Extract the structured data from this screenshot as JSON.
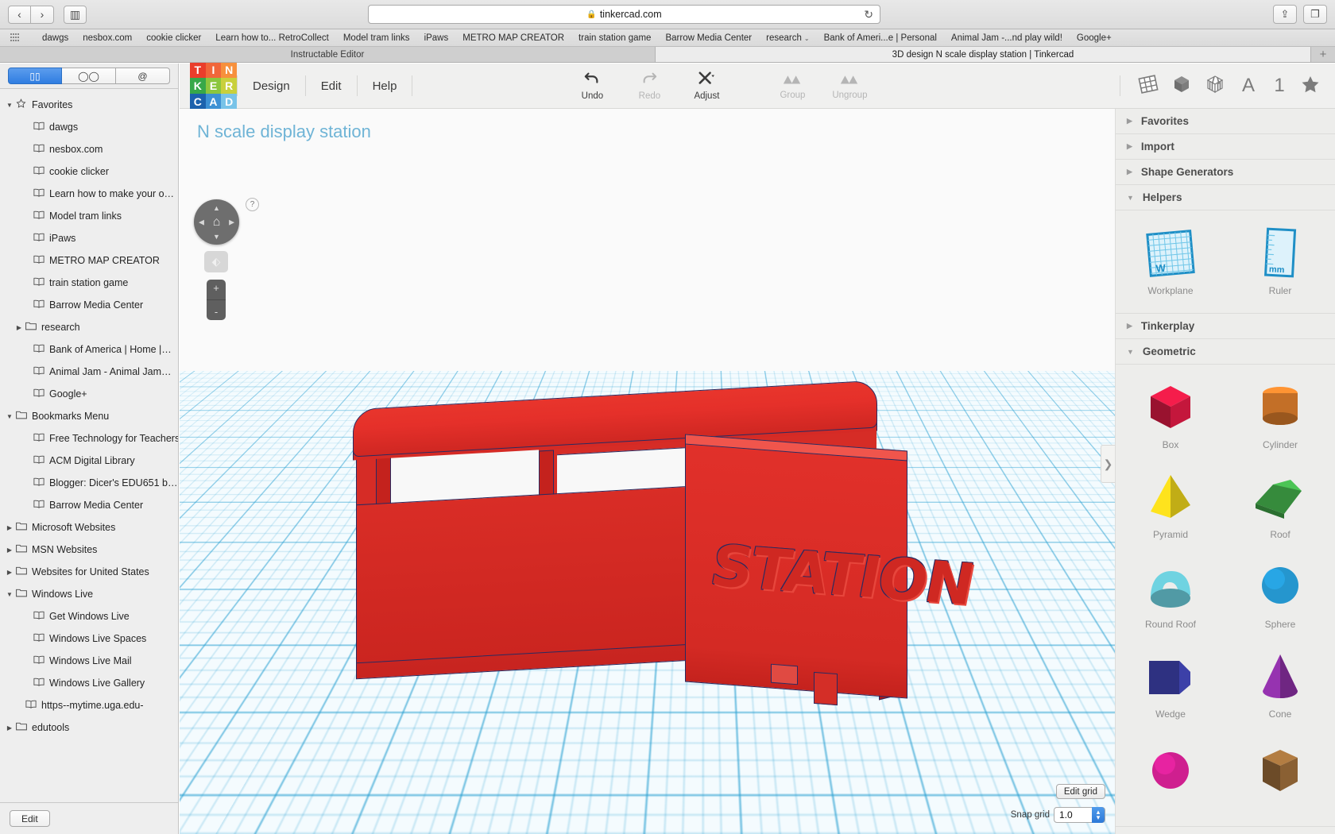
{
  "browser": {
    "back_label": "‹",
    "forward_label": "›",
    "sidebar_toggle_label": "▥",
    "url": "tinkercad.com",
    "lock_icon": "lock-icon",
    "reload_icon": "reload-icon",
    "share_label": "⇪",
    "tabs_overview_label": "❐",
    "bookmarks_bar": [
      {
        "label": "dawgs"
      },
      {
        "label": "nesbox.com"
      },
      {
        "label": "cookie clicker"
      },
      {
        "label": "Learn how to... RetroCollect"
      },
      {
        "label": "Model tram links"
      },
      {
        "label": "iPaws"
      },
      {
        "label": "METRO MAP CREATOR"
      },
      {
        "label": "train station game"
      },
      {
        "label": "Barrow Media Center"
      },
      {
        "label": "research",
        "caret": "⌄"
      },
      {
        "label": "Bank of Ameri...e | Personal"
      },
      {
        "label": "Animal Jam -...nd play wild!"
      },
      {
        "label": "Google+"
      }
    ],
    "tabs": [
      {
        "title": "Instructable Editor",
        "active": false
      },
      {
        "title": "3D design N scale display station | Tinkercad",
        "active": true
      }
    ],
    "new_tab_label": "+"
  },
  "sidebar": {
    "tabs": [
      {
        "icon": "bookmarks-icon",
        "glyph": "▯▯",
        "active": true
      },
      {
        "icon": "reading-list-icon",
        "glyph": "◯◯",
        "active": false
      },
      {
        "icon": "shared-links-icon",
        "glyph": "@",
        "active": false
      }
    ],
    "items": [
      {
        "label": "Favorites",
        "type": "folder",
        "tri": "▼",
        "icon": "star-icon",
        "glyph": "☆",
        "level": 0
      },
      {
        "label": "dawgs",
        "type": "bookmark",
        "icon": "book-icon",
        "glyph": "▥",
        "level": 1
      },
      {
        "label": "nesbox.com",
        "type": "bookmark",
        "icon": "book-icon",
        "glyph": "▥",
        "level": 1
      },
      {
        "label": "cookie clicker",
        "type": "bookmark",
        "icon": "book-icon",
        "glyph": "▥",
        "level": 1
      },
      {
        "label": "Learn how to make your o…",
        "type": "bookmark",
        "icon": "book-icon",
        "glyph": "▥",
        "level": 1
      },
      {
        "label": "Model tram links",
        "type": "bookmark",
        "icon": "book-icon",
        "glyph": "▥",
        "level": 1
      },
      {
        "label": "iPaws",
        "type": "bookmark",
        "icon": "book-icon",
        "glyph": "▥",
        "level": 1
      },
      {
        "label": "METRO MAP CREATOR",
        "type": "bookmark",
        "icon": "book-icon",
        "glyph": "▥",
        "level": 1
      },
      {
        "label": "train station game",
        "type": "bookmark",
        "icon": "book-icon",
        "glyph": "▥",
        "level": 1
      },
      {
        "label": "Barrow Media Center",
        "type": "bookmark",
        "icon": "book-icon",
        "glyph": "▥",
        "level": 1
      },
      {
        "label": "research",
        "type": "folder",
        "tri": "▶",
        "icon": "folder-icon",
        "glyph": "▭",
        "level": 1,
        "indentFolder": true
      },
      {
        "label": "Bank of America | Home |…",
        "type": "bookmark",
        "icon": "book-icon",
        "glyph": "▥",
        "level": 1
      },
      {
        "label": "Animal Jam - Animal Jam…",
        "type": "bookmark",
        "icon": "book-icon",
        "glyph": "▥",
        "level": 1
      },
      {
        "label": "Google+",
        "type": "bookmark",
        "icon": "book-icon",
        "glyph": "▥",
        "level": 1
      },
      {
        "label": "Bookmarks Menu",
        "type": "folder",
        "tri": "▼",
        "icon": "folder-icon",
        "glyph": "▭",
        "level": 0
      },
      {
        "label": "Free Technology for Teachers",
        "type": "bookmark",
        "icon": "book-icon",
        "glyph": "▥",
        "level": 1
      },
      {
        "label": "ACM Digital Library",
        "type": "bookmark",
        "icon": "book-icon",
        "glyph": "▥",
        "level": 1
      },
      {
        "label": "Blogger: Dicer's EDU651 b…",
        "type": "bookmark",
        "icon": "book-icon",
        "glyph": "▥",
        "level": 1
      },
      {
        "label": "Barrow Media Center",
        "type": "bookmark",
        "icon": "book-icon",
        "glyph": "▥",
        "level": 1
      },
      {
        "label": "Microsoft Websites",
        "type": "folder",
        "tri": "▶",
        "icon": "folder-icon",
        "glyph": "▭",
        "level": 0
      },
      {
        "label": "MSN Websites",
        "type": "folder",
        "tri": "▶",
        "icon": "folder-icon",
        "glyph": "▭",
        "level": 0
      },
      {
        "label": "Websites for United States",
        "type": "folder",
        "tri": "▶",
        "icon": "folder-icon",
        "glyph": "▭",
        "level": 0
      },
      {
        "label": "Windows Live",
        "type": "folder",
        "tri": "▼",
        "icon": "folder-icon",
        "glyph": "▭",
        "level": 0
      },
      {
        "label": "Get Windows Live",
        "type": "bookmark",
        "icon": "book-icon",
        "glyph": "▥",
        "level": 1
      },
      {
        "label": "Windows Live Spaces",
        "type": "bookmark",
        "icon": "book-icon",
        "glyph": "▥",
        "level": 1
      },
      {
        "label": "Windows Live Mail",
        "type": "bookmark",
        "icon": "book-icon",
        "glyph": "▥",
        "level": 1
      },
      {
        "label": "Windows Live Gallery",
        "type": "bookmark",
        "icon": "book-icon",
        "glyph": "▥",
        "level": 1
      },
      {
        "label": "https--mytime.uga.edu-",
        "type": "bookmark",
        "icon": "book-icon",
        "glyph": "▥",
        "level": 0,
        "halfIndent": true
      },
      {
        "label": "edutools",
        "type": "folder",
        "tri": "▶",
        "icon": "folder-icon",
        "glyph": "▭",
        "level": 0
      }
    ],
    "edit_button": "Edit"
  },
  "tinkercad": {
    "logo_letters": [
      {
        "ch": "T",
        "color": "#ea3d2b"
      },
      {
        "ch": "I",
        "color": "#f1663a"
      },
      {
        "ch": "N",
        "color": "#f7903c"
      },
      {
        "ch": "K",
        "color": "#37a849"
      },
      {
        "ch": "E",
        "color": "#8cc63e"
      },
      {
        "ch": "R",
        "color": "#c9d03c"
      },
      {
        "ch": "C",
        "color": "#1c62ad"
      },
      {
        "ch": "A",
        "color": "#3d91d4"
      },
      {
        "ch": "D",
        "color": "#78c3e8"
      }
    ],
    "menus": [
      {
        "label": "Design"
      },
      {
        "label": "Edit"
      },
      {
        "label": "Help"
      }
    ],
    "tools": [
      {
        "label": "Undo",
        "icon": "undo-icon",
        "glyph": "↶",
        "disabled": false
      },
      {
        "label": "Redo",
        "icon": "redo-icon",
        "glyph": "↷",
        "disabled": true
      },
      {
        "label": "Adjust",
        "icon": "adjust-icon",
        "glyph": "✄",
        "disabled": false
      },
      {
        "label": "Group",
        "icon": "group-icon",
        "glyph": "▲▲",
        "disabled": true
      },
      {
        "label": "Ungroup",
        "icon": "ungroup-icon",
        "glyph": "▲▲",
        "disabled": true
      }
    ],
    "right_icons": [
      {
        "icon": "workplane-grid-icon",
        "glyph": "▦"
      },
      {
        "icon": "solid-box-icon",
        "glyph": "⬢"
      },
      {
        "icon": "striped-box-icon",
        "glyph": "⬡"
      },
      {
        "icon": "text-tool-icon",
        "glyph": "A"
      },
      {
        "icon": "number-tool-icon",
        "glyph": "1"
      },
      {
        "icon": "star-tool-icon",
        "glyph": "★"
      }
    ],
    "design_title": "N scale display station",
    "model_text": "STATION",
    "help_badge": "?",
    "nav": {
      "up": "▲",
      "down": "▼",
      "left": "◀",
      "right": "▶",
      "home_icon": "home-icon",
      "home": "⌂",
      "fit_icon": "fit-view-icon",
      "fit": "⬖",
      "zoom_in": "+",
      "zoom_out": "-"
    },
    "edit_grid_button": "Edit grid",
    "snap_grid_label": "Snap grid",
    "snap_grid_value": "1.0",
    "panel_handle": "❯",
    "panel": {
      "sections": [
        {
          "name": "Favorites",
          "tri": "▶",
          "expanded": false,
          "shapes": []
        },
        {
          "name": "Import",
          "tri": "▶",
          "expanded": false,
          "shapes": []
        },
        {
          "name": "Shape Generators",
          "tri": "▶",
          "expanded": false,
          "shapes": []
        },
        {
          "name": "Helpers",
          "tri": "▼",
          "expanded": true,
          "shapes": [
            {
              "label": "Workplane",
              "kind": "workplane",
              "color": "#29a0d2",
              "badge": "W"
            },
            {
              "label": "Ruler",
              "kind": "ruler",
              "color": "#29a0d2",
              "badge": "mm"
            }
          ]
        },
        {
          "name": "Tinkerplay",
          "tri": "▶",
          "expanded": false,
          "shapes": []
        },
        {
          "name": "Geometric",
          "tri": "▼",
          "expanded": true,
          "shapes": [
            {
              "label": "Box",
              "kind": "box",
              "color": "#c4173c"
            },
            {
              "label": "Cylinder",
              "kind": "cylinder",
              "color": "#d4792a"
            },
            {
              "label": "Pyramid",
              "kind": "pyramid",
              "color": "#e3cb1a"
            },
            {
              "label": "Roof",
              "kind": "roof",
              "color": "#3fa347"
            },
            {
              "label": "Round Roof",
              "kind": "roundroof",
              "color": "#63bcc9"
            },
            {
              "label": "Sphere",
              "kind": "sphere",
              "color": "#2596ce"
            },
            {
              "label": "Wedge",
              "kind": "wedge",
              "color": "#2e3181"
            },
            {
              "label": "Cone",
              "kind": "cone",
              "color": "#8b2fa3"
            },
            {
              "label": "",
              "kind": "sphere2",
              "color": "#cf1f8f"
            },
            {
              "label": "",
              "kind": "hex",
              "color": "#8a6033"
            }
          ]
        }
      ]
    }
  }
}
